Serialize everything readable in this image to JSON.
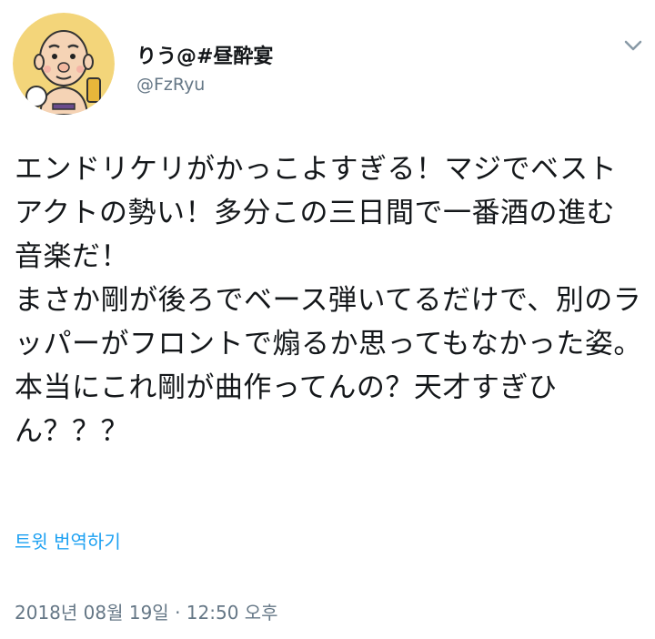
{
  "tweet": {
    "author": {
      "display_name": "りう@#昼酔宴",
      "handle": "@FzRyu",
      "avatar_icon": "avatar-image"
    },
    "menu_icon": "chevron-down-icon",
    "text": "エンドリケリがかっこよすぎる！マジでベストアクトの勢い！多分この三日間で一番酒の進む音楽だ！\nまさか剛が後ろでベース弾いてるだけで、別のラッパーがフロントで煽るか思ってもなかった姿。\n本当にこれ剛が曲作ってんの？天才すぎひん？？？",
    "translate_label": "트윗 번역하기",
    "timestamp": "2018년 08월 19일 · 12:50 오후"
  },
  "colors": {
    "text": "#14171a",
    "secondary": "#657786",
    "link": "#1da1f2",
    "avatar_bg": "#f3d57a"
  }
}
